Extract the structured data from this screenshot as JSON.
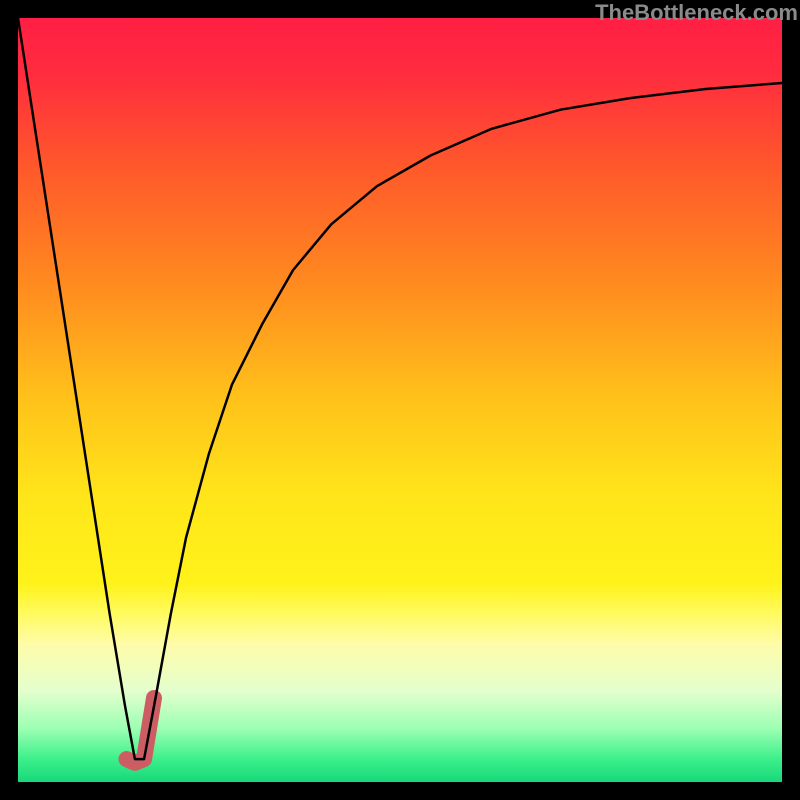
{
  "watermark": {
    "text": "TheBottleneck.com"
  },
  "gradient": {
    "stops": [
      {
        "offset": 0.0,
        "color": "#ff1f44"
      },
      {
        "offset": 0.07,
        "color": "#ff2b3f"
      },
      {
        "offset": 0.2,
        "color": "#ff5a2a"
      },
      {
        "offset": 0.35,
        "color": "#ff8b1f"
      },
      {
        "offset": 0.5,
        "color": "#ffc21a"
      },
      {
        "offset": 0.63,
        "color": "#ffe61a"
      },
      {
        "offset": 0.74,
        "color": "#fff21a"
      },
      {
        "offset": 0.78,
        "color": "#fffb60"
      },
      {
        "offset": 0.82,
        "color": "#fffcaa"
      },
      {
        "offset": 0.88,
        "color": "#e4ffcd"
      },
      {
        "offset": 0.93,
        "color": "#9cffb4"
      },
      {
        "offset": 0.97,
        "color": "#3cf08a"
      },
      {
        "offset": 1.0,
        "color": "#17d87a"
      }
    ]
  },
  "chart_data": {
    "type": "line",
    "title": "",
    "xlabel": "",
    "ylabel": "",
    "xlim": [
      0,
      100
    ],
    "ylim": [
      0,
      100
    ],
    "grid": false,
    "series": [
      {
        "name": "bottleneck-curve",
        "x": [
          0,
          2,
          4,
          6,
          8,
          10,
          12,
          14,
          15.3,
          16.5,
          18,
          20,
          22,
          25,
          28,
          32,
          36,
          41,
          47,
          54,
          62,
          71,
          80,
          90,
          100
        ],
        "y": [
          100,
          87,
          74,
          61,
          48,
          35,
          22,
          10,
          3,
          3,
          11,
          22,
          32,
          43,
          52,
          60,
          67,
          73,
          78,
          82,
          85.5,
          88,
          89.5,
          90.7,
          91.5
        ]
      }
    ],
    "highlight_segment": {
      "name": "highlight-stub",
      "x": [
        14.2,
        15.3,
        16.5,
        17.8
      ],
      "y": [
        3,
        2.5,
        3,
        11
      ]
    },
    "min_point": {
      "x": 15.3,
      "y": 2.5
    }
  },
  "style": {
    "curve_stroke": "#000000",
    "curve_width": 2.5,
    "highlight_stroke": "#cc5e63",
    "highlight_width": 16
  }
}
